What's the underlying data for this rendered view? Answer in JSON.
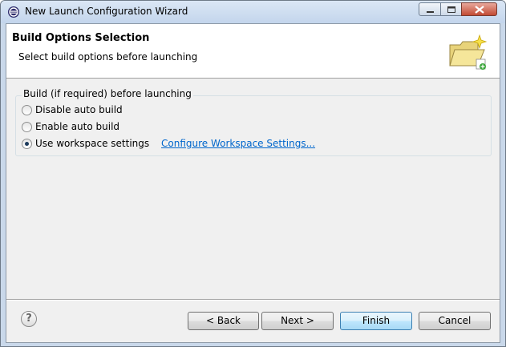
{
  "window": {
    "title": "New Launch Configuration Wizard"
  },
  "header": {
    "title": "Build Options Selection",
    "description": "Select build options before launching"
  },
  "build_group": {
    "label": "Build (if required) before launching",
    "options": [
      {
        "label": "Disable auto build",
        "checked": false
      },
      {
        "label": "Enable auto build",
        "checked": false
      },
      {
        "label": "Use workspace settings",
        "checked": true
      }
    ],
    "link_text": "Configure Workspace Settings..."
  },
  "footer": {
    "help_glyph": "?",
    "back_label": "< Back",
    "next_label": "Next >",
    "finish_label": "Finish",
    "cancel_label": "Cancel"
  },
  "colors": {
    "link": "#0066cc",
    "title_bar": "#c3d5ec",
    "client_bg": "#f0f0f0"
  }
}
